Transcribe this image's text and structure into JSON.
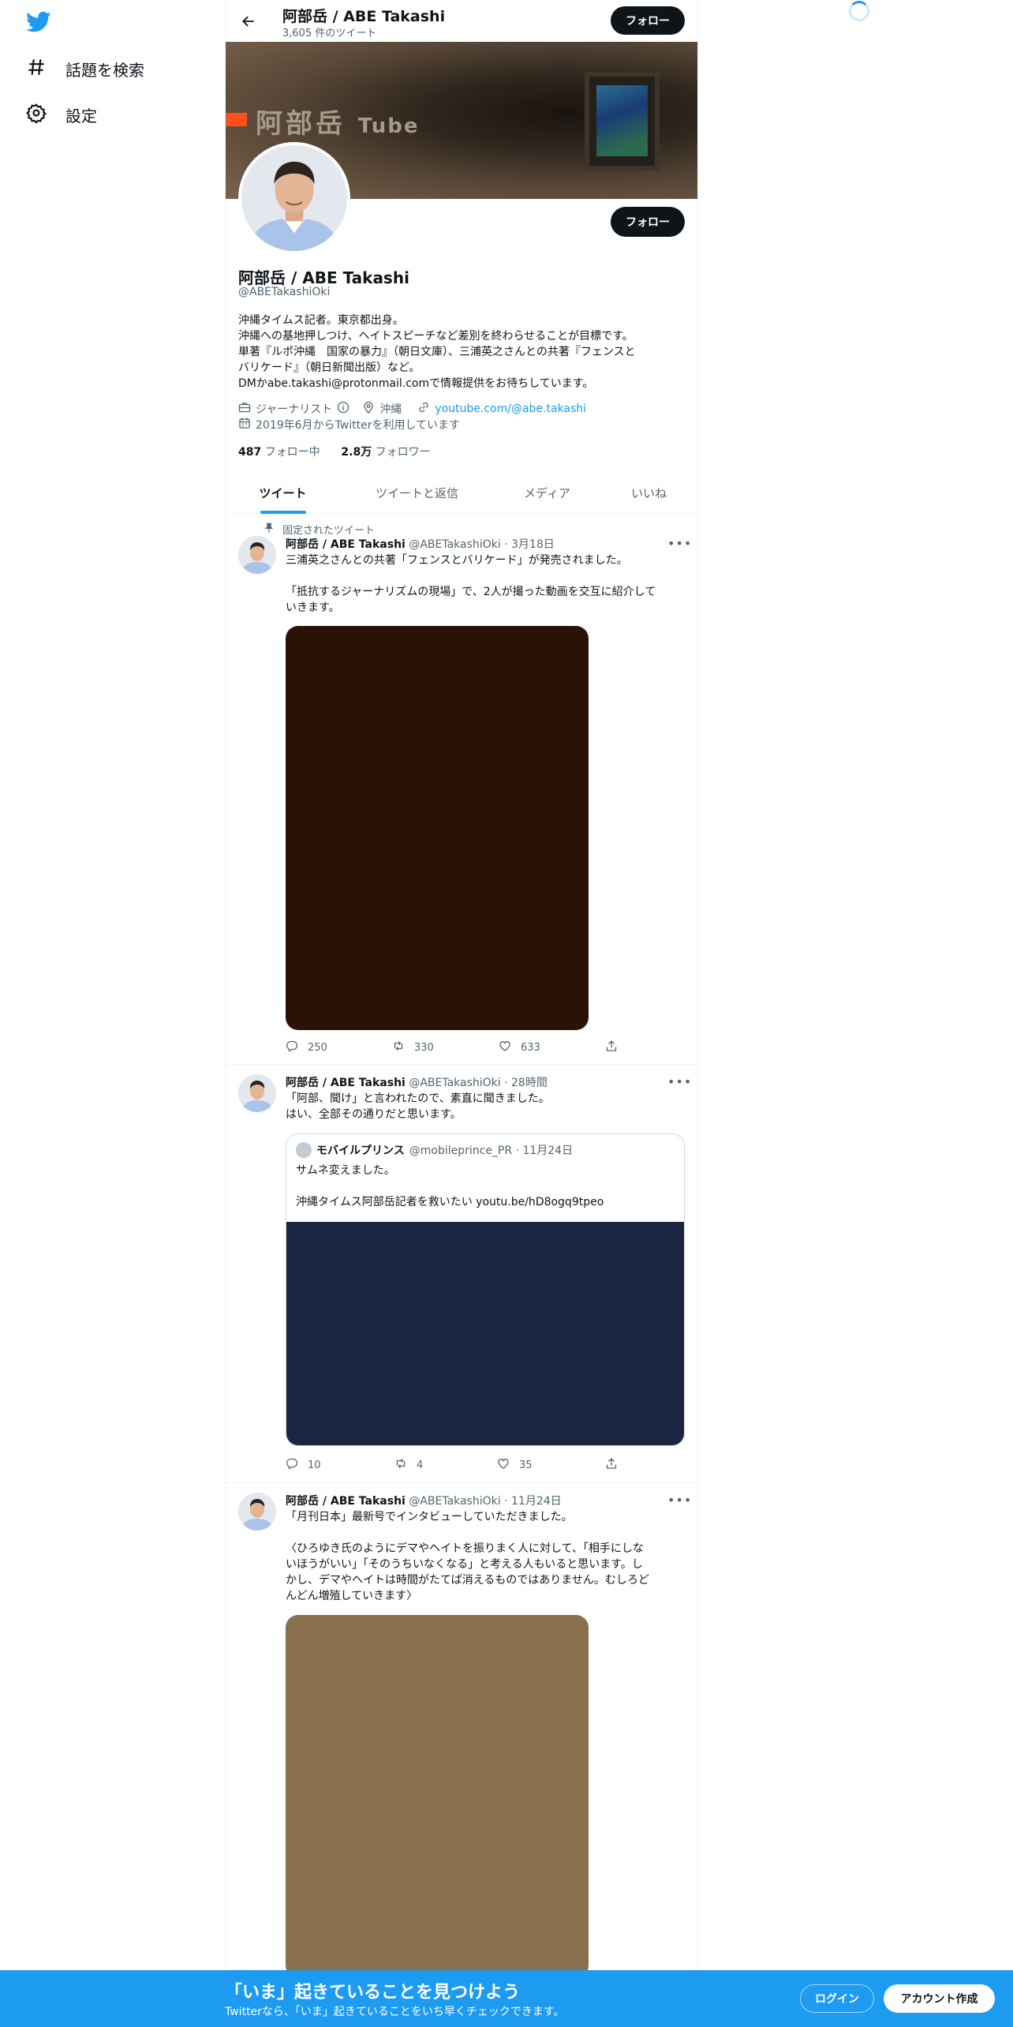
{
  "nav": {
    "explore_label": "話題を検索",
    "settings_label": "設定"
  },
  "header": {
    "name": "阿部岳 / ABE Takashi",
    "tweet_count": "3,605 件のツイート",
    "follow_label": "フォロー"
  },
  "banner": {
    "title_main": "阿部岳",
    "title_sub": "Tube"
  },
  "profile": {
    "name": "阿部岳 / ABE Takashi",
    "handle": "@ABETakashiOki",
    "follow_label": "フォロー",
    "bio": [
      "沖縄タイムス記者。東京都出身。",
      "沖縄への基地押しつけ、ヘイトスピーチなど差別を終わらせることが目標です。",
      "単著『ルポ沖縄　国家の暴力』（朝日文庫）、三浦英之さんとの共著『フェンスと",
      "バリケード』（朝日新聞出版）など。",
      "DMかabe.takashi@protonmail.comで情報提供をお待ちしています。"
    ],
    "job": "ジャーナリスト",
    "location": "沖縄",
    "link": "youtube.com/@abe.takashi",
    "joined": "2019年6月からTwitterを利用しています",
    "following_count": "487",
    "following_label": "フォロー中",
    "followers_count": "2.8万",
    "followers_label": "フォロワー"
  },
  "tabs": [
    "ツイート",
    "ツイートと返信",
    "メディア",
    "いいね"
  ],
  "tweets": [
    {
      "pinned_label": "固定されたツイート",
      "name": "阿部岳 / ABE Takashi",
      "meta": "@ABETakashiOki · 3月18日",
      "text": [
        "三浦英之さんとの共著「フェンスとバリケード」が発売されました。",
        "",
        "「抵抗するジャーナリズムの現場」で、2人が撮った動画を交互に紹介して",
        "いきます。"
      ],
      "media_color": "#2a1206",
      "replies": "250",
      "retweets": "330",
      "likes": "633"
    },
    {
      "name": "阿部岳 / ABE Takashi",
      "meta": "@ABETakashiOki · 28時間",
      "text": [
        "「阿部、聞け」と言われたので、素直に聞きました。",
        "はい、全部その通りだと思います。"
      ],
      "quote": {
        "name": "モバイルプリンス",
        "meta": "@mobileprince_PR · 11月24日",
        "text": [
          "サムネ変えました。",
          "",
          "沖縄タイムス阿部岳記者を救いたい youtu.be/hD8ogq9tpeo"
        ],
        "media_color": "#1b2440"
      },
      "replies": "10",
      "retweets": "4",
      "likes": "35"
    },
    {
      "name": "阿部岳 / ABE Takashi",
      "meta": "@ABETakashiOki · 11月24日",
      "text": [
        "「月刊日本」最新号でインタビューしていただきました。",
        "",
        "〈ひろゆき氏のようにデマやヘイトを振りまく人に対して、「相手にしな",
        "いほうがいい」「そのうちいなくなる」と考える人もいると思います。し",
        "かし、デマやヘイトは時間がたてば消えるものではありません。むしろど",
        "んどん増殖していきます〉"
      ],
      "media_color": "#88704e"
    }
  ],
  "bottom_bar": {
    "title": "「いま」起きていることを見つけよう",
    "subtitle": "Twitterなら、「いま」起きていることをいち早くチェックできます。",
    "login_label": "ログイン",
    "signup_label": "アカウント作成"
  },
  "colors": {
    "accent": "#1d9bf0",
    "text": "#0f1419",
    "muted": "#536471",
    "banner_stripe": "#ff4f18"
  },
  "icons": [
    "twitter-logo-icon",
    "hashtag-icon",
    "gear-icon",
    "back-arrow-icon",
    "briefcase-icon",
    "info-icon",
    "location-pin-icon",
    "link-icon",
    "calendar-icon",
    "pin-icon",
    "reply-icon",
    "retweet-icon",
    "like-icon",
    "share-icon",
    "more-icon"
  ]
}
